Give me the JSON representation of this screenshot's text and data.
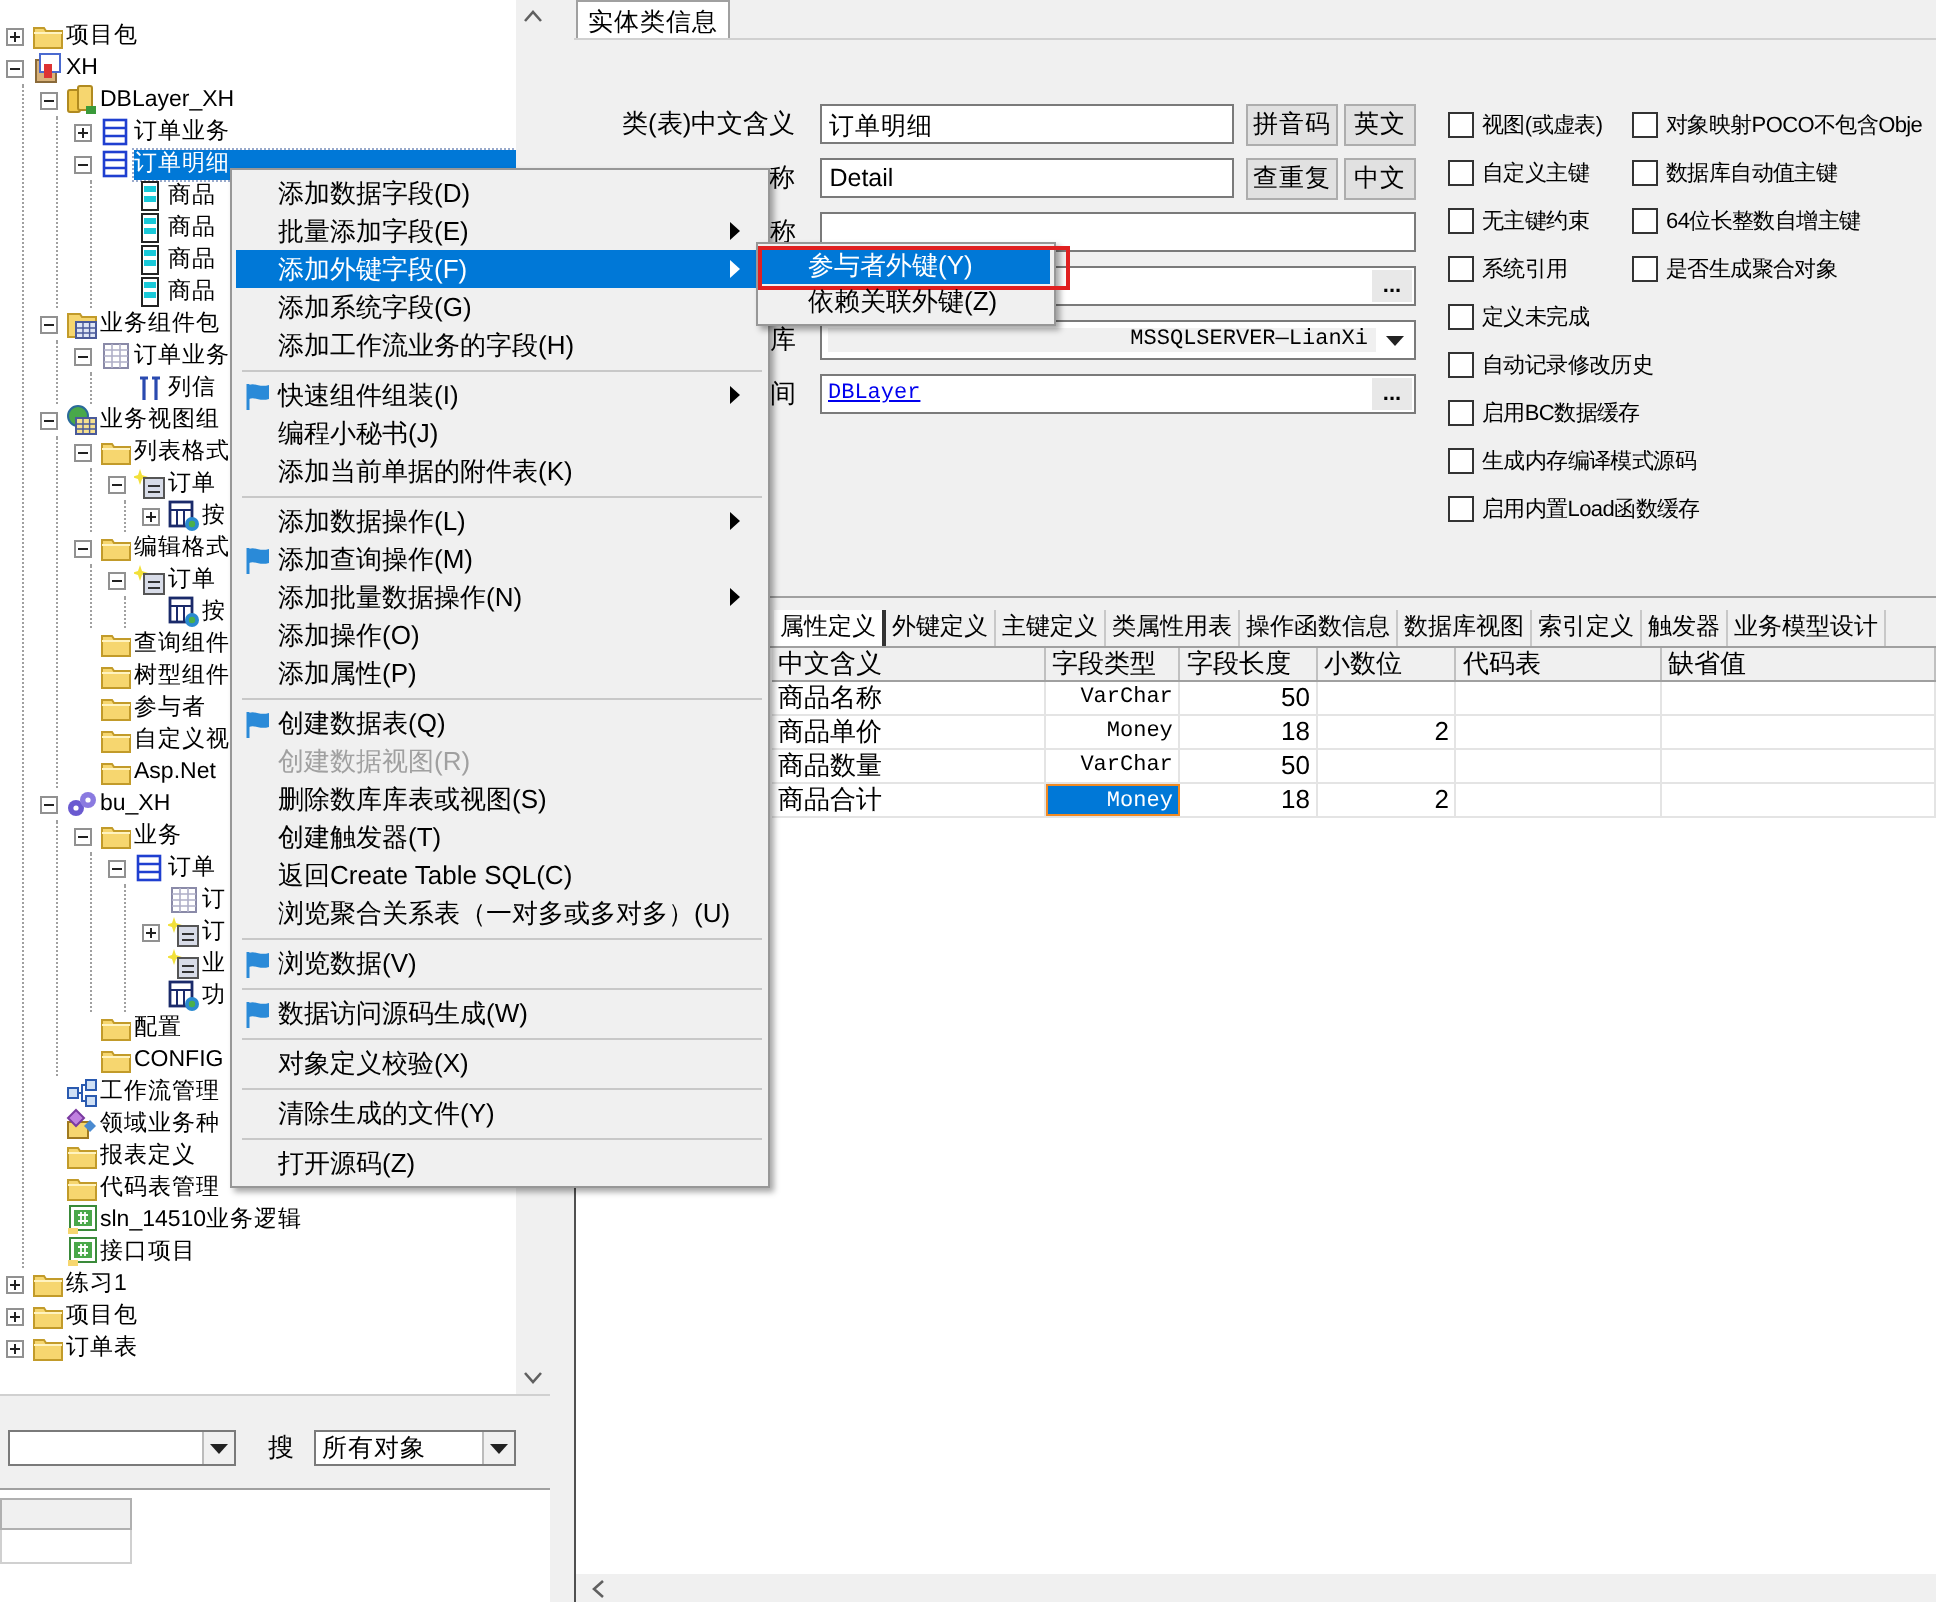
{
  "tree": [
    {
      "label": "项目包",
      "kind": "folder",
      "expanded": false,
      "selected": false
    },
    {
      "label": "XH",
      "kind": "project",
      "expanded": true,
      "selected": false,
      "children": [
        {
          "label": "DBLayer_XH",
          "kind": "dblayer",
          "expanded": true,
          "selected": false,
          "children": [
            {
              "label": "订单业务",
              "kind": "table",
              "expanded": false,
              "selected": false
            },
            {
              "label": "订单明细",
              "kind": "table",
              "expanded": true,
              "selected": true,
              "children": [
                {
                  "label": "商品",
                  "kind": "field",
                  "selected": false
                },
                {
                  "label": "商品",
                  "kind": "field",
                  "selected": false
                },
                {
                  "label": "商品",
                  "kind": "field",
                  "selected": false
                },
                {
                  "label": "商品",
                  "kind": "field",
                  "selected": false
                }
              ]
            }
          ]
        },
        {
          "label": "业务组件包",
          "kind": "component",
          "expanded": true,
          "selected": false,
          "children": [
            {
              "label": "订单业务",
              "kind": "grid",
              "expanded": true,
              "selected": false,
              "children": [
                {
                  "label": "列信",
                  "kind": "columns",
                  "selected": false
                }
              ]
            }
          ]
        },
        {
          "label": "业务视图组",
          "kind": "view",
          "expanded": true,
          "selected": false,
          "children": [
            {
              "label": "列表格式",
              "kind": "folder",
              "expanded": true,
              "selected": false,
              "children": [
                {
                  "label": "订单",
                  "kind": "form",
                  "expanded": true,
                  "selected": false,
                  "children": [
                    {
                      "label": "按",
                      "kind": "button",
                      "expanded": false,
                      "selected": false
                    }
                  ]
                }
              ]
            },
            {
              "label": "编辑格式",
              "kind": "folder",
              "expanded": true,
              "selected": false,
              "children": [
                {
                  "label": "订单",
                  "kind": "form",
                  "expanded": true,
                  "selected": false,
                  "children": [
                    {
                      "label": "按",
                      "kind": "button",
                      "selected": false
                    }
                  ]
                }
              ]
            },
            {
              "label": "查询组件",
              "kind": "folder",
              "selected": false
            },
            {
              "label": "树型组件",
              "kind": "folder",
              "selected": false
            },
            {
              "label": "参与者",
              "kind": "folder",
              "selected": false
            },
            {
              "label": "自定义视",
              "kind": "folder",
              "selected": false
            },
            {
              "label": "Asp.Net",
              "kind": "folder",
              "selected": false
            }
          ]
        },
        {
          "label": "bu_XH",
          "kind": "gears",
          "expanded": true,
          "selected": false,
          "children": [
            {
              "label": "业务",
              "kind": "folder",
              "expanded": true,
              "selected": false,
              "children": [
                {
                  "label": "订单",
                  "kind": "table",
                  "expanded": true,
                  "selected": false,
                  "children": [
                    {
                      "label": "订",
                      "kind": "grid",
                      "selected": false
                    },
                    {
                      "label": "订",
                      "kind": "form",
                      "expanded": false,
                      "selected": false
                    },
                    {
                      "label": "业",
                      "kind": "form",
                      "selected": false
                    },
                    {
                      "label": "功",
                      "kind": "button",
                      "selected": false
                    }
                  ]
                }
              ]
            },
            {
              "label": "配置",
              "kind": "folder",
              "selected": false
            },
            {
              "label": "CONFIG",
              "kind": "folder",
              "selected": false
            }
          ]
        },
        {
          "label": "工作流管理",
          "kind": "workflow",
          "selected": false
        },
        {
          "label": "领域业务种",
          "kind": "domain",
          "selected": false
        },
        {
          "label": "报表定义",
          "kind": "folder",
          "selected": false
        },
        {
          "label": "代码表管理",
          "kind": "folder",
          "selected": false
        },
        {
          "label": "sln_14510业务逻辑",
          "kind": "csharp",
          "selected": false
        },
        {
          "label": "接口项目",
          "kind": "csharp",
          "selected": false
        }
      ]
    },
    {
      "label": "练习1",
      "kind": "folder",
      "expanded": false,
      "selected": false
    },
    {
      "label": "项目包",
      "kind": "folder",
      "expanded": false,
      "selected": false
    },
    {
      "label": "订单表",
      "kind": "folder",
      "expanded": false,
      "selected": false
    }
  ],
  "search": {
    "label": "搜",
    "scope": "所有对象"
  },
  "top_tabs": [
    {
      "label": "实体类信息",
      "selected": true
    }
  ],
  "form": [
    {
      "kind": "text",
      "label": "类(表)中文含义",
      "value": "订单明细",
      "buttons": [
        "拼音码",
        "英文"
      ]
    },
    {
      "kind": "text",
      "label": "称",
      "value": "Detail",
      "buttons": [
        "查重复",
        "中文"
      ]
    },
    {
      "kind": "wide",
      "label": "称"
    },
    {
      "kind": "browse",
      "button": "..."
    },
    {
      "kind": "dropdown",
      "label": "库",
      "value": "MSSQLSERVER—LianXi"
    },
    {
      "kind": "browse",
      "label": "间",
      "value": "DBLayer",
      "link": true,
      "button": "..."
    }
  ],
  "options_left": [
    {
      "label": "视图(或虚表)",
      "checked": false
    },
    {
      "label": "自定义主键",
      "checked": false
    },
    {
      "label": "无主键约束",
      "checked": false
    },
    {
      "label": "系统引用",
      "checked": false
    },
    {
      "label": "定义未完成",
      "checked": false
    },
    {
      "label": "自动记录修改历史",
      "checked": false
    },
    {
      "label": "启用BC数据缓存",
      "checked": false
    },
    {
      "label": "生成内存编译模式源码",
      "checked": false
    },
    {
      "label": "启用内置Load函数缓存",
      "checked": false
    }
  ],
  "options_right": [
    {
      "label": "对象映射POCO不包含Obje",
      "checked": false
    },
    {
      "label": "数据库自动值主键",
      "checked": false
    },
    {
      "label": "64位长整数自增主键",
      "checked": false
    },
    {
      "label": "是否生成聚合对象",
      "checked": false
    }
  ],
  "bottom_tabs": [
    {
      "label": "属性定义",
      "selected": true
    },
    {
      "label": "外键定义",
      "selected": false
    },
    {
      "label": "主键定义",
      "selected": false
    },
    {
      "label": "类属性用表",
      "selected": false
    },
    {
      "label": "操作函数信息",
      "selected": false
    },
    {
      "label": "数据库视图",
      "selected": false
    },
    {
      "label": "索引定义",
      "selected": false
    },
    {
      "label": "触发器",
      "selected": false
    },
    {
      "label": "业务模型设计",
      "selected": false
    }
  ],
  "table": {
    "columns": [
      "中文含义",
      "字段类型",
      "字段长度",
      "小数位",
      "代码表",
      "缺省值"
    ],
    "rows": [
      {
        "cells": [
          {
            "text": "商品名称",
            "selected": false
          },
          {
            "text": "VarChar",
            "selected": false
          },
          {
            "text": "50",
            "selected": false
          },
          {
            "selected": false
          },
          {
            "selected": false
          },
          {
            "selected": false
          }
        ]
      },
      {
        "cells": [
          {
            "text": "商品单价",
            "selected": false
          },
          {
            "text": "Money",
            "selected": false
          },
          {
            "text": "18",
            "selected": false
          },
          {
            "text": "2",
            "selected": false
          },
          {
            "selected": false
          },
          {
            "selected": false
          }
        ]
      },
      {
        "cells": [
          {
            "text": "商品数量",
            "selected": false
          },
          {
            "text": "VarChar",
            "selected": false
          },
          {
            "text": "50",
            "selected": false
          },
          {
            "selected": false
          },
          {
            "selected": false
          },
          {
            "selected": false
          }
        ]
      },
      {
        "cells": [
          {
            "text": "商品合计",
            "selected": false
          },
          {
            "text": "Money",
            "selected": true
          },
          {
            "text": "18",
            "selected": false
          },
          {
            "text": "2",
            "selected": false
          },
          {
            "selected": false
          },
          {
            "selected": false
          }
        ]
      }
    ]
  },
  "menu": [
    {
      "kind": "item",
      "label": "添加数据字段(D)",
      "selected": false,
      "disabled": false,
      "submenu": false,
      "flag": false
    },
    {
      "kind": "item",
      "label": "批量添加字段(E)",
      "selected": false,
      "disabled": false,
      "submenu": true,
      "flag": false
    },
    {
      "kind": "item",
      "label": "添加外键字段(F)",
      "selected": true,
      "disabled": false,
      "submenu": true,
      "flag": false
    },
    {
      "kind": "item",
      "label": "添加系统字段(G)",
      "selected": false,
      "disabled": false,
      "submenu": false,
      "flag": false
    },
    {
      "kind": "item",
      "label": "添加工作流业务的字段(H)",
      "selected": false,
      "disabled": false,
      "submenu": false,
      "flag": false
    },
    {
      "kind": "separator"
    },
    {
      "kind": "item",
      "label": "快速组件组装(I)",
      "selected": false,
      "disabled": false,
      "submenu": true,
      "flag": true
    },
    {
      "kind": "item",
      "label": "编程小秘书(J)",
      "selected": false,
      "disabled": false,
      "submenu": false,
      "flag": false
    },
    {
      "kind": "item",
      "label": "添加当前单据的附件表(K)",
      "selected": false,
      "disabled": false,
      "submenu": false,
      "flag": false
    },
    {
      "kind": "separator"
    },
    {
      "kind": "item",
      "label": "添加数据操作(L)",
      "selected": false,
      "disabled": false,
      "submenu": true,
      "flag": false
    },
    {
      "kind": "item",
      "label": "添加查询操作(M)",
      "selected": false,
      "disabled": false,
      "submenu": false,
      "flag": true
    },
    {
      "kind": "item",
      "label": "添加批量数据操作(N)",
      "selected": false,
      "disabled": false,
      "submenu": true,
      "flag": false
    },
    {
      "kind": "item",
      "label": "添加操作(O)",
      "selected": false,
      "disabled": false,
      "submenu": false,
      "flag": false
    },
    {
      "kind": "item",
      "label": "添加属性(P)",
      "selected": false,
      "disabled": false,
      "submenu": false,
      "flag": false
    },
    {
      "kind": "separator"
    },
    {
      "kind": "item",
      "label": "创建数据表(Q)",
      "selected": false,
      "disabled": false,
      "submenu": false,
      "flag": true
    },
    {
      "kind": "item",
      "label": "创建数据视图(R)",
      "selected": false,
      "disabled": true,
      "submenu": false,
      "flag": false
    },
    {
      "kind": "item",
      "label": "删除数库库表或视图(S)",
      "selected": false,
      "disabled": false,
      "submenu": false,
      "flag": false
    },
    {
      "kind": "item",
      "label": "创建触发器(T)",
      "selected": false,
      "disabled": false,
      "submenu": false,
      "flag": false
    },
    {
      "kind": "item",
      "label": "返回Create Table SQL(C)",
      "selected": false,
      "disabled": false,
      "submenu": false,
      "flag": false
    },
    {
      "kind": "item",
      "label": "浏览聚合关系表（一对多或多对多）(U)",
      "selected": false,
      "disabled": false,
      "submenu": false,
      "flag": false
    },
    {
      "kind": "separator"
    },
    {
      "kind": "item",
      "label": "浏览数据(V)",
      "selected": false,
      "disabled": false,
      "submenu": false,
      "flag": true
    },
    {
      "kind": "separator"
    },
    {
      "kind": "item",
      "label": "数据访问源码生成(W)",
      "selected": false,
      "disabled": false,
      "submenu": false,
      "flag": true
    },
    {
      "kind": "separator"
    },
    {
      "kind": "item",
      "label": "对象定义校验(X)",
      "selected": false,
      "disabled": false,
      "submenu": false,
      "flag": false
    },
    {
      "kind": "separator"
    },
    {
      "kind": "item",
      "label": "清除生成的文件(Y)",
      "selected": false,
      "disabled": false,
      "submenu": false,
      "flag": false
    },
    {
      "kind": "separator"
    },
    {
      "kind": "item",
      "label": "打开源码(Z)",
      "selected": false,
      "disabled": false,
      "submenu": false,
      "flag": false
    }
  ],
  "submenu": [
    {
      "label": "参与者外键(Y)",
      "selected": true,
      "marked": true
    },
    {
      "label": "依赖关联外键(Z)",
      "selected": false,
      "marked": false
    }
  ]
}
